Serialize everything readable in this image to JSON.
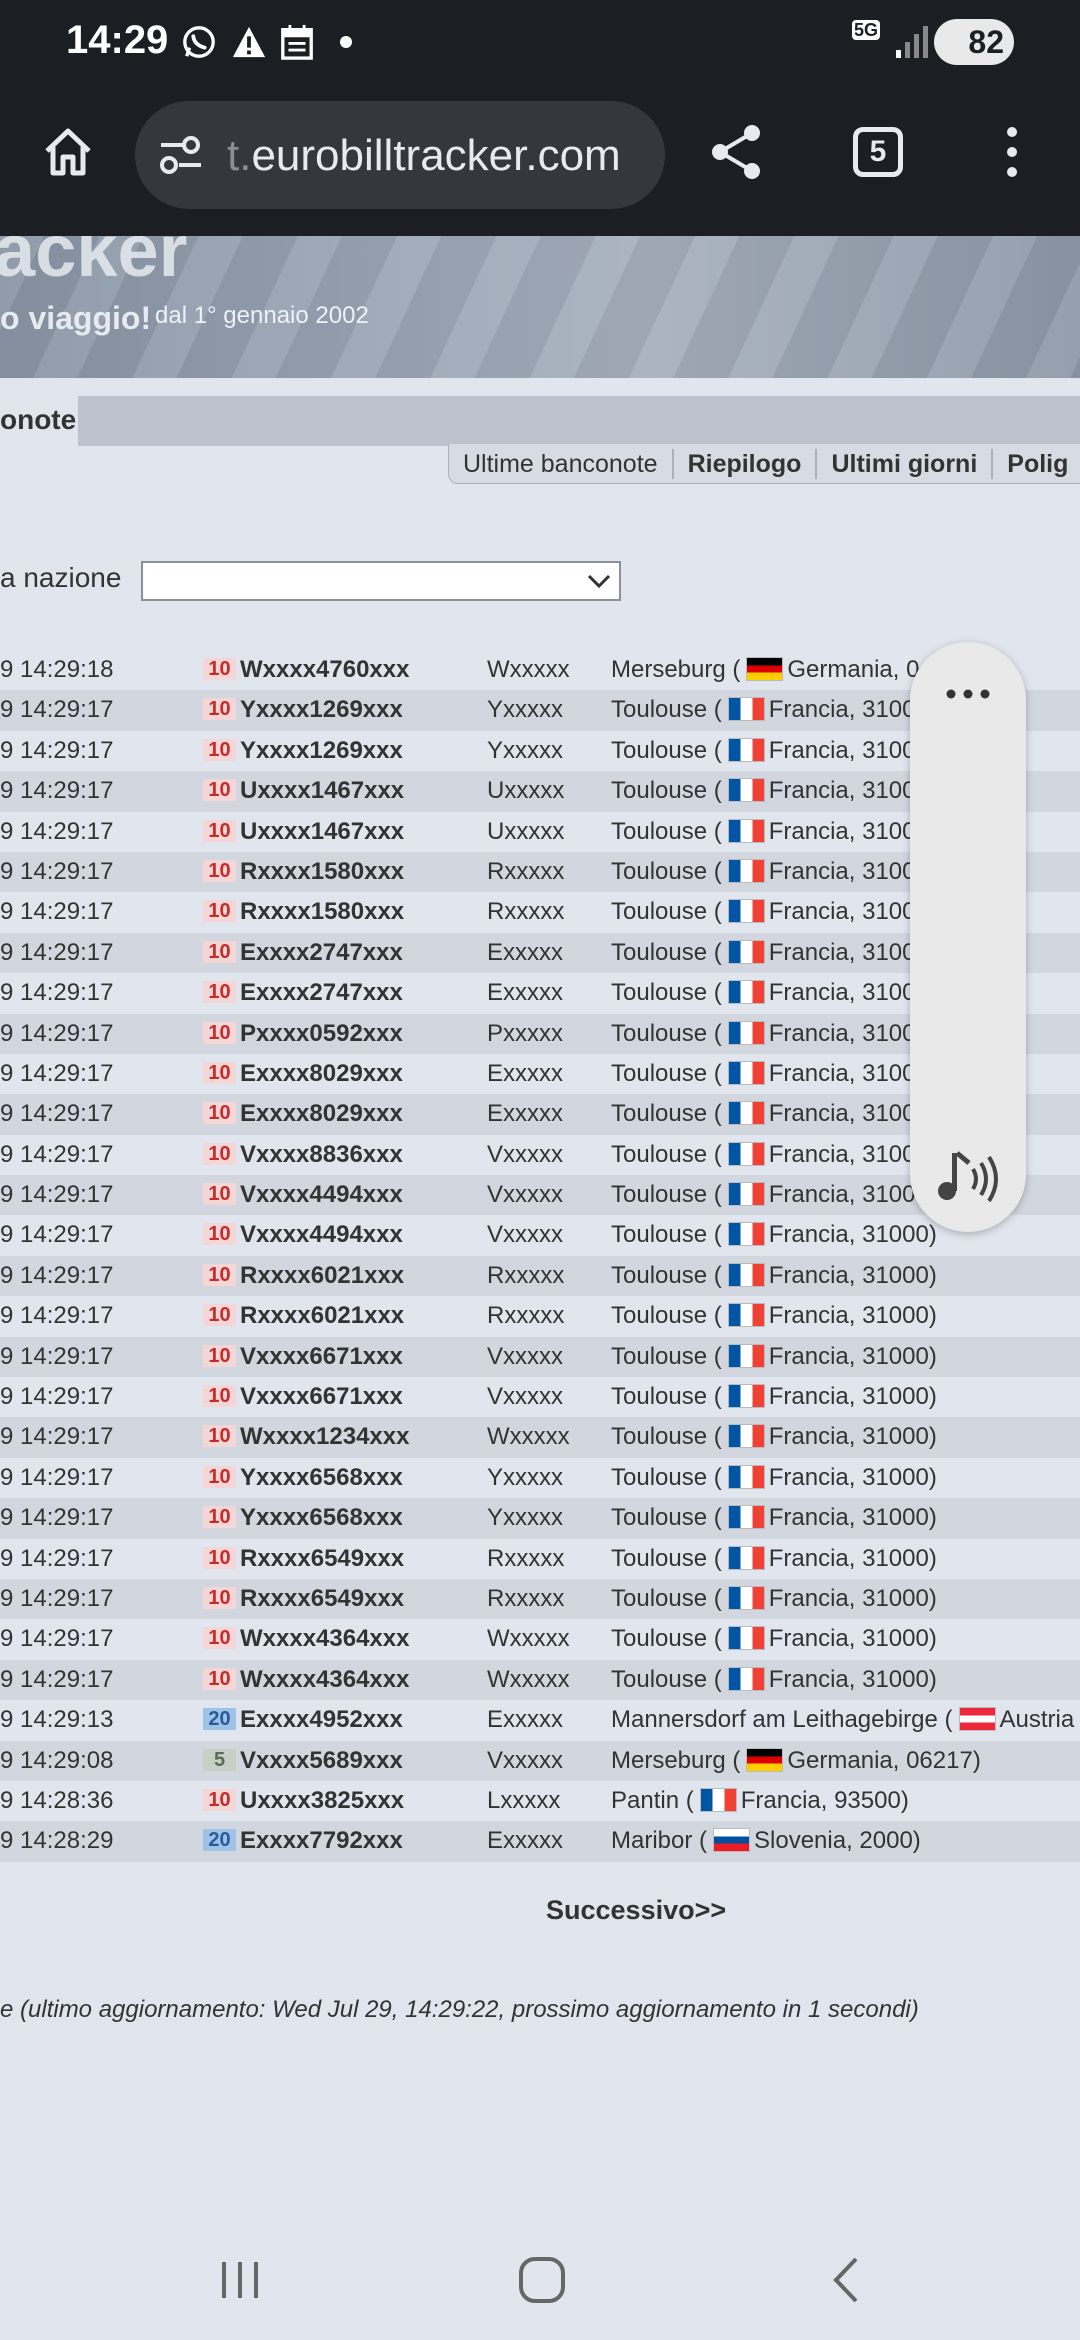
{
  "status_bar": {
    "time": "14:29",
    "network": "5G",
    "battery": "82",
    "icons": [
      "whatsapp-icon",
      "warning-icon",
      "calendar-icon",
      "dot-icon",
      "signal-icon"
    ]
  },
  "browser": {
    "url_faded": "t.",
    "url_main": "eurobilltracker.com",
    "tab_count": "5",
    "icons": [
      "home-icon",
      "site-settings-icon",
      "share-icon",
      "more-icon"
    ]
  },
  "banner": {
    "logo": "acker",
    "tagline": "o viaggio!",
    "since": "dal 1° gennaio 2002"
  },
  "section": {
    "title": "onote",
    "tabs": [
      {
        "label": "Ultime banconote",
        "bold": false
      },
      {
        "label": "Riepilogo",
        "bold": true
      },
      {
        "label": "Ultimi giorni",
        "bold": true
      },
      {
        "label": "Polig",
        "bold": true
      }
    ]
  },
  "filter": {
    "label": "a nazione",
    "selected": ""
  },
  "rows": [
    {
      "time": "9 14:29:18",
      "denom": "10",
      "serial": "Wxxxx4760xxx",
      "short": "Wxxxxx",
      "city": "Merseburg (",
      "flag": "de",
      "country": "Germania, 0"
    },
    {
      "time": "9 14:29:17",
      "denom": "10",
      "serial": "Yxxxx1269xxx",
      "short": "Yxxxxx",
      "city": "Toulouse (",
      "flag": "fr",
      "country": "Francia, 3100"
    },
    {
      "time": "9 14:29:17",
      "denom": "10",
      "serial": "Yxxxx1269xxx",
      "short": "Yxxxxx",
      "city": "Toulouse (",
      "flag": "fr",
      "country": "Francia, 3100"
    },
    {
      "time": "9 14:29:17",
      "denom": "10",
      "serial": "Uxxxx1467xxx",
      "short": "Uxxxxx",
      "city": "Toulouse (",
      "flag": "fr",
      "country": "Francia, 3100"
    },
    {
      "time": "9 14:29:17",
      "denom": "10",
      "serial": "Uxxxx1467xxx",
      "short": "Uxxxxx",
      "city": "Toulouse (",
      "flag": "fr",
      "country": "Francia, 3100"
    },
    {
      "time": "9 14:29:17",
      "denom": "10",
      "serial": "Rxxxx1580xxx",
      "short": "Rxxxxx",
      "city": "Toulouse (",
      "flag": "fr",
      "country": "Francia, 3100"
    },
    {
      "time": "9 14:29:17",
      "denom": "10",
      "serial": "Rxxxx1580xxx",
      "short": "Rxxxxx",
      "city": "Toulouse (",
      "flag": "fr",
      "country": "Francia, 3100"
    },
    {
      "time": "9 14:29:17",
      "denom": "10",
      "serial": "Exxxx2747xxx",
      "short": "Exxxxx",
      "city": "Toulouse (",
      "flag": "fr",
      "country": "Francia, 3100"
    },
    {
      "time": "9 14:29:17",
      "denom": "10",
      "serial": "Exxxx2747xxx",
      "short": "Exxxxx",
      "city": "Toulouse (",
      "flag": "fr",
      "country": "Francia, 3100"
    },
    {
      "time": "9 14:29:17",
      "denom": "10",
      "serial": "Pxxxx0592xxx",
      "short": "Pxxxxx",
      "city": "Toulouse (",
      "flag": "fr",
      "country": "Francia, 3100"
    },
    {
      "time": "9 14:29:17",
      "denom": "10",
      "serial": "Exxxx8029xxx",
      "short": "Exxxxx",
      "city": "Toulouse (",
      "flag": "fr",
      "country": "Francia, 3100"
    },
    {
      "time": "9 14:29:17",
      "denom": "10",
      "serial": "Exxxx8029xxx",
      "short": "Exxxxx",
      "city": "Toulouse (",
      "flag": "fr",
      "country": "Francia, 3100"
    },
    {
      "time": "9 14:29:17",
      "denom": "10",
      "serial": "Vxxxx8836xxx",
      "short": "Vxxxxx",
      "city": "Toulouse (",
      "flag": "fr",
      "country": "Francia, 3100"
    },
    {
      "time": "9 14:29:17",
      "denom": "10",
      "serial": "Vxxxx4494xxx",
      "short": "Vxxxxx",
      "city": "Toulouse (",
      "flag": "fr",
      "country": "Francia, 3100"
    },
    {
      "time": "9 14:29:17",
      "denom": "10",
      "serial": "Vxxxx4494xxx",
      "short": "Vxxxxx",
      "city": "Toulouse (",
      "flag": "fr",
      "country": "Francia, 31000)"
    },
    {
      "time": "9 14:29:17",
      "denom": "10",
      "serial": "Rxxxx6021xxx",
      "short": "Rxxxxx",
      "city": "Toulouse (",
      "flag": "fr",
      "country": "Francia, 31000)"
    },
    {
      "time": "9 14:29:17",
      "denom": "10",
      "serial": "Rxxxx6021xxx",
      "short": "Rxxxxx",
      "city": "Toulouse (",
      "flag": "fr",
      "country": "Francia, 31000)"
    },
    {
      "time": "9 14:29:17",
      "denom": "10",
      "serial": "Vxxxx6671xxx",
      "short": "Vxxxxx",
      "city": "Toulouse (",
      "flag": "fr",
      "country": "Francia, 31000)"
    },
    {
      "time": "9 14:29:17",
      "denom": "10",
      "serial": "Vxxxx6671xxx",
      "short": "Vxxxxx",
      "city": "Toulouse (",
      "flag": "fr",
      "country": "Francia, 31000)"
    },
    {
      "time": "9 14:29:17",
      "denom": "10",
      "serial": "Wxxxx1234xxx",
      "short": "Wxxxxx",
      "city": "Toulouse (",
      "flag": "fr",
      "country": "Francia, 31000)"
    },
    {
      "time": "9 14:29:17",
      "denom": "10",
      "serial": "Yxxxx6568xxx",
      "short": "Yxxxxx",
      "city": "Toulouse (",
      "flag": "fr",
      "country": "Francia, 31000)"
    },
    {
      "time": "9 14:29:17",
      "denom": "10",
      "serial": "Yxxxx6568xxx",
      "short": "Yxxxxx",
      "city": "Toulouse (",
      "flag": "fr",
      "country": "Francia, 31000)"
    },
    {
      "time": "9 14:29:17",
      "denom": "10",
      "serial": "Rxxxx6549xxx",
      "short": "Rxxxxx",
      "city": "Toulouse (",
      "flag": "fr",
      "country": "Francia, 31000)"
    },
    {
      "time": "9 14:29:17",
      "denom": "10",
      "serial": "Rxxxx6549xxx",
      "short": "Rxxxxx",
      "city": "Toulouse (",
      "flag": "fr",
      "country": "Francia, 31000)"
    },
    {
      "time": "9 14:29:17",
      "denom": "10",
      "serial": "Wxxxx4364xxx",
      "short": "Wxxxxx",
      "city": "Toulouse (",
      "flag": "fr",
      "country": "Francia, 31000)"
    },
    {
      "time": "9 14:29:17",
      "denom": "10",
      "serial": "Wxxxx4364xxx",
      "short": "Wxxxxx",
      "city": "Toulouse (",
      "flag": "fr",
      "country": "Francia, 31000)"
    },
    {
      "time": "9 14:29:13",
      "denom": "20",
      "serial": "Exxxx4952xxx",
      "short": "Exxxxx",
      "city": "Mannersdorf am Leithagebirge (",
      "flag": "at",
      "country": "Austria"
    },
    {
      "time": "9 14:29:08",
      "denom": "5",
      "serial": "Vxxxx5689xxx",
      "short": "Vxxxxx",
      "city": "Merseburg (",
      "flag": "de",
      "country": "Germania, 06217)"
    },
    {
      "time": "9 14:28:36",
      "denom": "10",
      "serial": "Uxxxx3825xxx",
      "short": "Lxxxxx",
      "city": "Pantin (",
      "flag": "fr",
      "country": "Francia, 93500)"
    },
    {
      "time": "9 14:28:29",
      "denom": "20",
      "serial": "Exxxx7792xxx",
      "short": "Exxxxx",
      "city": "Maribor (",
      "flag": "si",
      "country": "Slovenia, 2000)"
    }
  ],
  "pagination": {
    "next": "Successivo>>"
  },
  "footer_note": "e (ultimo aggiornamento: Wed Jul 29, 14:29:22, prossimo aggiornamento in 1 secondi)",
  "float_panel": {
    "icons": [
      "more-horizontal-icon",
      "read-aloud-icon"
    ]
  },
  "nav": {
    "icons": [
      "recents-icon",
      "home-nav-icon",
      "back-icon"
    ]
  }
}
